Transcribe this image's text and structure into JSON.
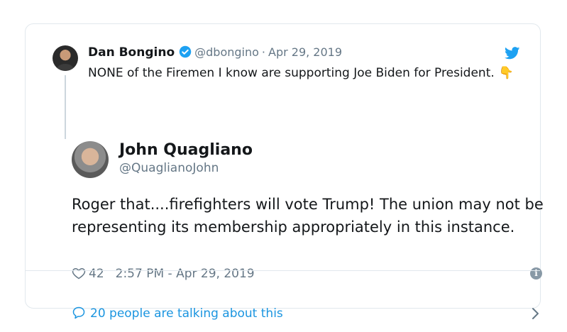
{
  "parent_tweet": {
    "author_name": "Dan Bongino",
    "handle": "@dbongino",
    "separator": "·",
    "date": "Apr 29, 2019",
    "text": "NONE of the Firemen I know are supporting Joe Biden for President.",
    "emoji": "👇"
  },
  "tweet": {
    "author_name": "John Quagliano",
    "handle": "@QuaglianoJohn",
    "text": "Roger that....firefighters will vote Trump! The union may not be representing its membership appropriately in this instance.",
    "likes": "42",
    "timestamp": "2:57 PM - Apr 29, 2019"
  },
  "footer": {
    "conversation_text": "20 people are talking about this"
  },
  "icons": {
    "brand": "twitter-bird-icon",
    "verified": "verified-badge-icon",
    "like": "heart-icon",
    "info": "info-icon",
    "reply": "speech-bubble-icon",
    "chevron": "chevron-right-icon"
  },
  "colors": {
    "accent": "#1b95e0",
    "twitter_blue": "#1da1f2",
    "muted": "#657786",
    "border": "#e1e8ed"
  }
}
